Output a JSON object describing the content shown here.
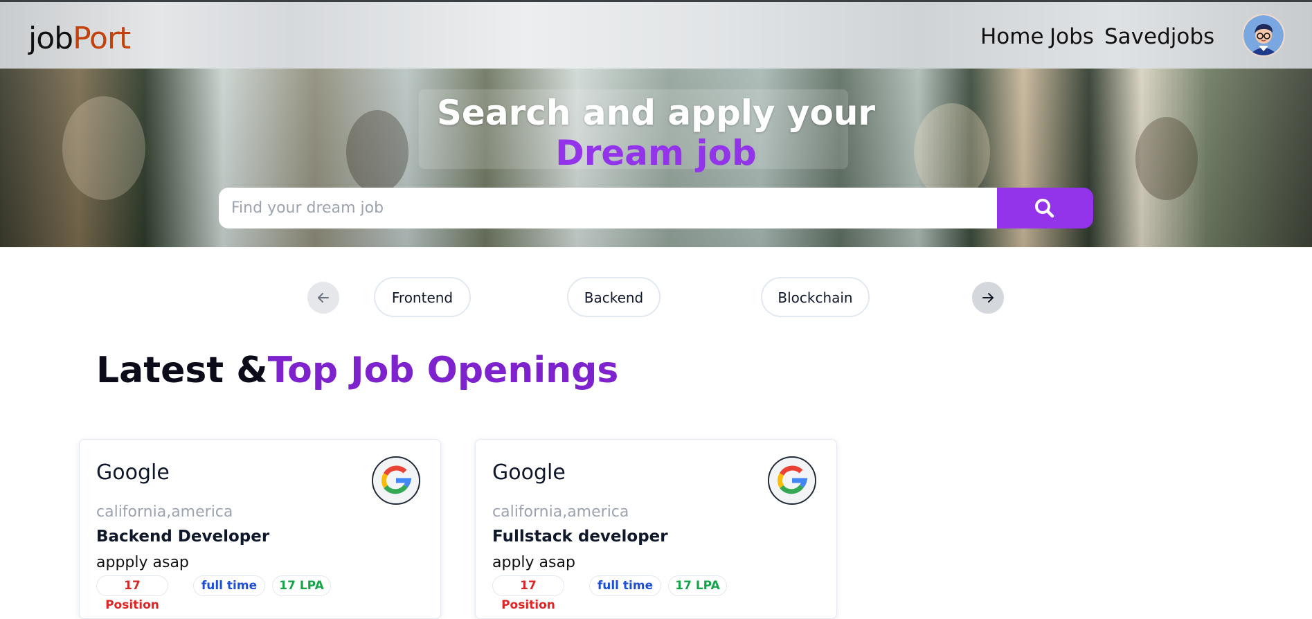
{
  "brand": {
    "part1": "job",
    "part2": "Port"
  },
  "nav": {
    "home": "Home",
    "jobs": "Jobs",
    "saved": "Savedjobs"
  },
  "hero": {
    "title_line1": "Search and apply your",
    "title_line2": "Dream job",
    "search_placeholder": "Find your dream job",
    "search_value": ""
  },
  "categories": [
    "Frontend",
    "Backend",
    "Blockchain"
  ],
  "section": {
    "title_part1": "Latest &",
    "title_part2": "Top Job Openings"
  },
  "jobs": [
    {
      "company": "Google",
      "location": "california,america",
      "title": "Backend Developer",
      "description": "appply asap",
      "positions": "17 Position",
      "type": "full time",
      "salary": "17 LPA"
    },
    {
      "company": "Google",
      "location": "california,america",
      "title": "Fullstack developer",
      "description": "apply asap",
      "positions": "17 Position",
      "type": "full time",
      "salary": "17 LPA"
    }
  ],
  "icons": {
    "search": "search-icon",
    "prev": "arrow-left-icon",
    "next": "arrow-right-icon",
    "avatar": "user-avatar",
    "company_logo": "google-logo"
  },
  "colors": {
    "accent": "#9333ea",
    "brand_orange": "#c2410c",
    "title_purple": "#7e22ce",
    "badge_red": "#dc2626",
    "badge_blue": "#1d4ed8",
    "badge_green": "#16a34a"
  }
}
